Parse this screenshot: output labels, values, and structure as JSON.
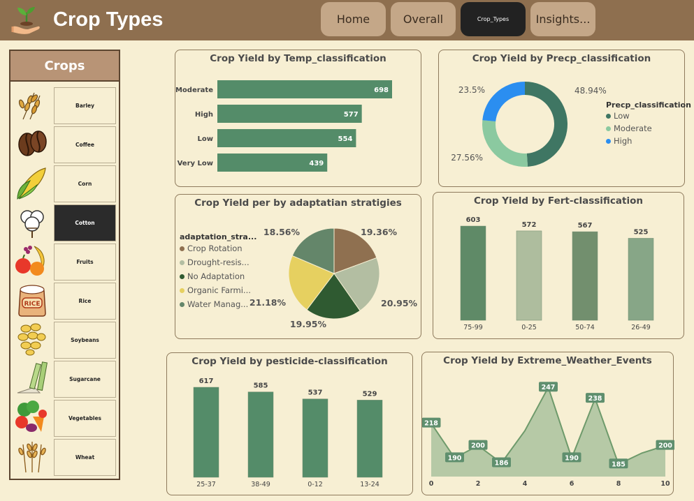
{
  "header": {
    "title": "Crop Types",
    "nav": [
      {
        "label": "Home"
      },
      {
        "label": "Overall"
      },
      {
        "label": "Crop_Types"
      },
      {
        "label": "Insights..."
      }
    ]
  },
  "crops": {
    "title": "Crops",
    "items": [
      {
        "label": "Barley",
        "icon": "barley-icon"
      },
      {
        "label": "Coffee",
        "icon": "coffee-bean-icon"
      },
      {
        "label": "Corn",
        "icon": "corn-icon"
      },
      {
        "label": "Cotton",
        "icon": "cotton-icon"
      },
      {
        "label": "Fruits",
        "icon": "fruits-icon"
      },
      {
        "label": "Rice",
        "icon": "rice-bag-icon"
      },
      {
        "label": "Soybeans",
        "icon": "soybeans-icon"
      },
      {
        "label": "Sugarcane",
        "icon": "sugarcane-icon"
      },
      {
        "label": "Vegetables",
        "icon": "vegetables-icon"
      },
      {
        "label": "Wheat",
        "icon": "wheat-icon"
      }
    ],
    "selected": "Cotton"
  },
  "chart_data": [
    {
      "type": "bar",
      "orientation": "horizontal",
      "title": "Crop Yield by Temp_classification",
      "categories": [
        "Moderate",
        "High",
        "Low",
        "Very Low"
      ],
      "values": [
        698,
        577,
        554,
        439
      ],
      "color": "#548c69"
    },
    {
      "type": "pie",
      "variant": "donut",
      "title": "Crop Yield by Precp_classification",
      "legend_title": "Precp_classification",
      "legend_position": "right",
      "categories": [
        "Low",
        "Moderate",
        "High"
      ],
      "values": [
        48.94,
        27.56,
        23.5
      ],
      "labels": [
        "48.94%",
        "27.56%",
        "23.5%"
      ],
      "colors": [
        "#3f7663",
        "#8bc9a0",
        "#2b8ef0"
      ]
    },
    {
      "type": "pie",
      "title": "Crop Yield per by adaptatian stratigies",
      "legend_title": "adaptation_stra...",
      "legend_position": "left",
      "categories": [
        "Crop Rotation",
        "Drought-resis...",
        "No Adaptation",
        "Organic Farmi...",
        "Water Manag..."
      ],
      "values": [
        19.36,
        20.95,
        19.95,
        21.18,
        18.56
      ],
      "labels": [
        "19.36%",
        "20.95%",
        "19.95%",
        "21.18%",
        "18.56%"
      ],
      "colors": [
        "#8f7050",
        "#b3bea2",
        "#2f5a31",
        "#e6d060",
        "#64866a"
      ]
    },
    {
      "type": "bar",
      "title": "Crop Yield by Fert-classification",
      "categories": [
        "75-99",
        "0-25",
        "50-74",
        "26-49"
      ],
      "values": [
        603,
        572,
        567,
        525
      ],
      "colors": [
        "#5f8a67",
        "#aebd9e",
        "#728f6e",
        "#87a687"
      ]
    },
    {
      "type": "bar",
      "title": "Crop Yield by pesticide-classification",
      "categories": [
        "25-37",
        "38-49",
        "0-12",
        "13-24"
      ],
      "values": [
        617,
        585,
        537,
        529
      ],
      "color": "#548c69"
    },
    {
      "type": "area",
      "title": "Crop Yield by Extreme_Weather_Events",
      "x": [
        0,
        1,
        2,
        3,
        4,
        5,
        6,
        7,
        8,
        9,
        10
      ],
      "y": [
        218,
        190,
        200,
        186,
        212,
        247,
        190,
        238,
        185,
        194,
        200
      ],
      "labeled_points": [
        0,
        1,
        2,
        3,
        5,
        6,
        7,
        8,
        10
      ],
      "x_ticks": [
        "0",
        "2",
        "4",
        "6",
        "8",
        "10"
      ],
      "color": "#6e9a6b"
    }
  ]
}
